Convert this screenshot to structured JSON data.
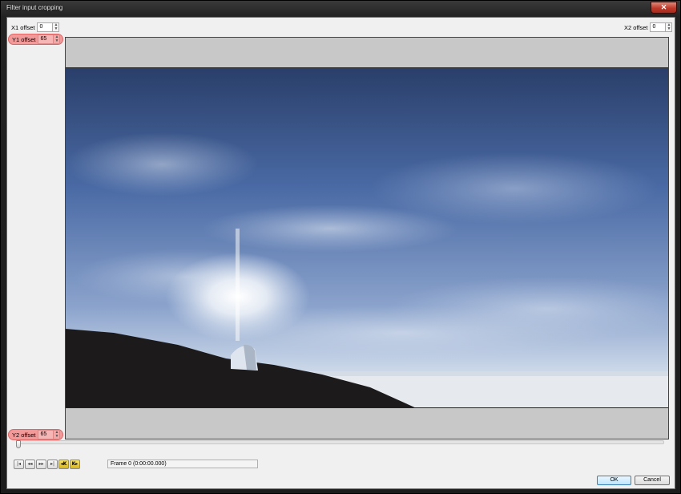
{
  "window": {
    "title": "Filter input cropping",
    "close_label": "✕"
  },
  "offsets": {
    "x1": {
      "label": "X1 offset",
      "value": "0"
    },
    "y1": {
      "label": "Y1 offset",
      "value": "65"
    },
    "x2": {
      "label": "X2 offset",
      "value": "0"
    },
    "y2": {
      "label": "Y2 offset",
      "value": "65"
    }
  },
  "transport": {
    "icons": [
      "go-to-start-icon",
      "previous-frame-icon",
      "next-frame-icon",
      "go-to-end-icon",
      "previous-keyframe-icon",
      "next-keyframe-icon"
    ],
    "labels": [
      "|◂",
      "◂◂",
      "▸▸",
      "▸|",
      "◂K",
      "K▸"
    ]
  },
  "frame_info": "Frame 0 (0:00:00.000)",
  "buttons": {
    "ok": "OK",
    "cancel": "Cancel"
  },
  "slider": {
    "position": 0
  },
  "colors": {
    "highlight": "#f29a9a",
    "crop_bars": "#c8c8c8",
    "title_bar": "#222222"
  }
}
